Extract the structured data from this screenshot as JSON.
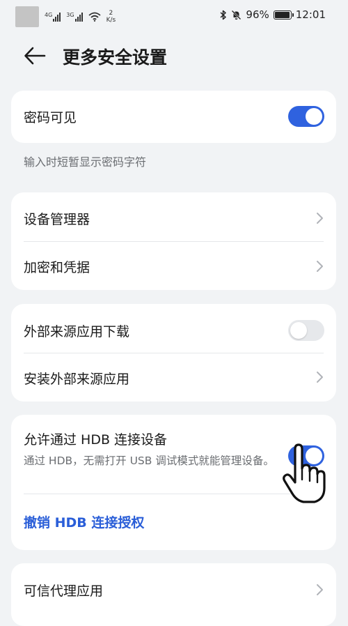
{
  "status_bar": {
    "sim1_label": "4G",
    "sim2_label": "3G",
    "speed_value": "2",
    "speed_unit": "K/s",
    "battery_text": "96%",
    "battery_level": 0.96,
    "time": "12:01",
    "icons": [
      "signal-icon",
      "wifi-icon",
      "bluetooth-icon",
      "mute-bell-icon",
      "battery-icon"
    ]
  },
  "header": {
    "title": "更多安全设置"
  },
  "password_card": {
    "label": "密码可见",
    "enabled": true,
    "caption": "输入时短暂显示密码字符"
  },
  "admin_card": {
    "items": [
      {
        "label": "设备管理器"
      },
      {
        "label": "加密和凭据"
      }
    ]
  },
  "external_card": {
    "download_label": "外部来源应用下载",
    "download_enabled": false,
    "install_label": "安装外部来源应用"
  },
  "hdb_card": {
    "label": "允许通过 HDB 连接设备",
    "description": "通过 HDB，无需打开 USB 调试模式就能管理设备。",
    "enabled": true,
    "revoke_label": "撤销 HDB 连接授权"
  },
  "trusted_card": {
    "label": "可信代理应用"
  },
  "colors": {
    "accent": "#2f62df",
    "link": "#2a5ed8",
    "background": "#f1f3f5",
    "card": "#ffffff"
  }
}
